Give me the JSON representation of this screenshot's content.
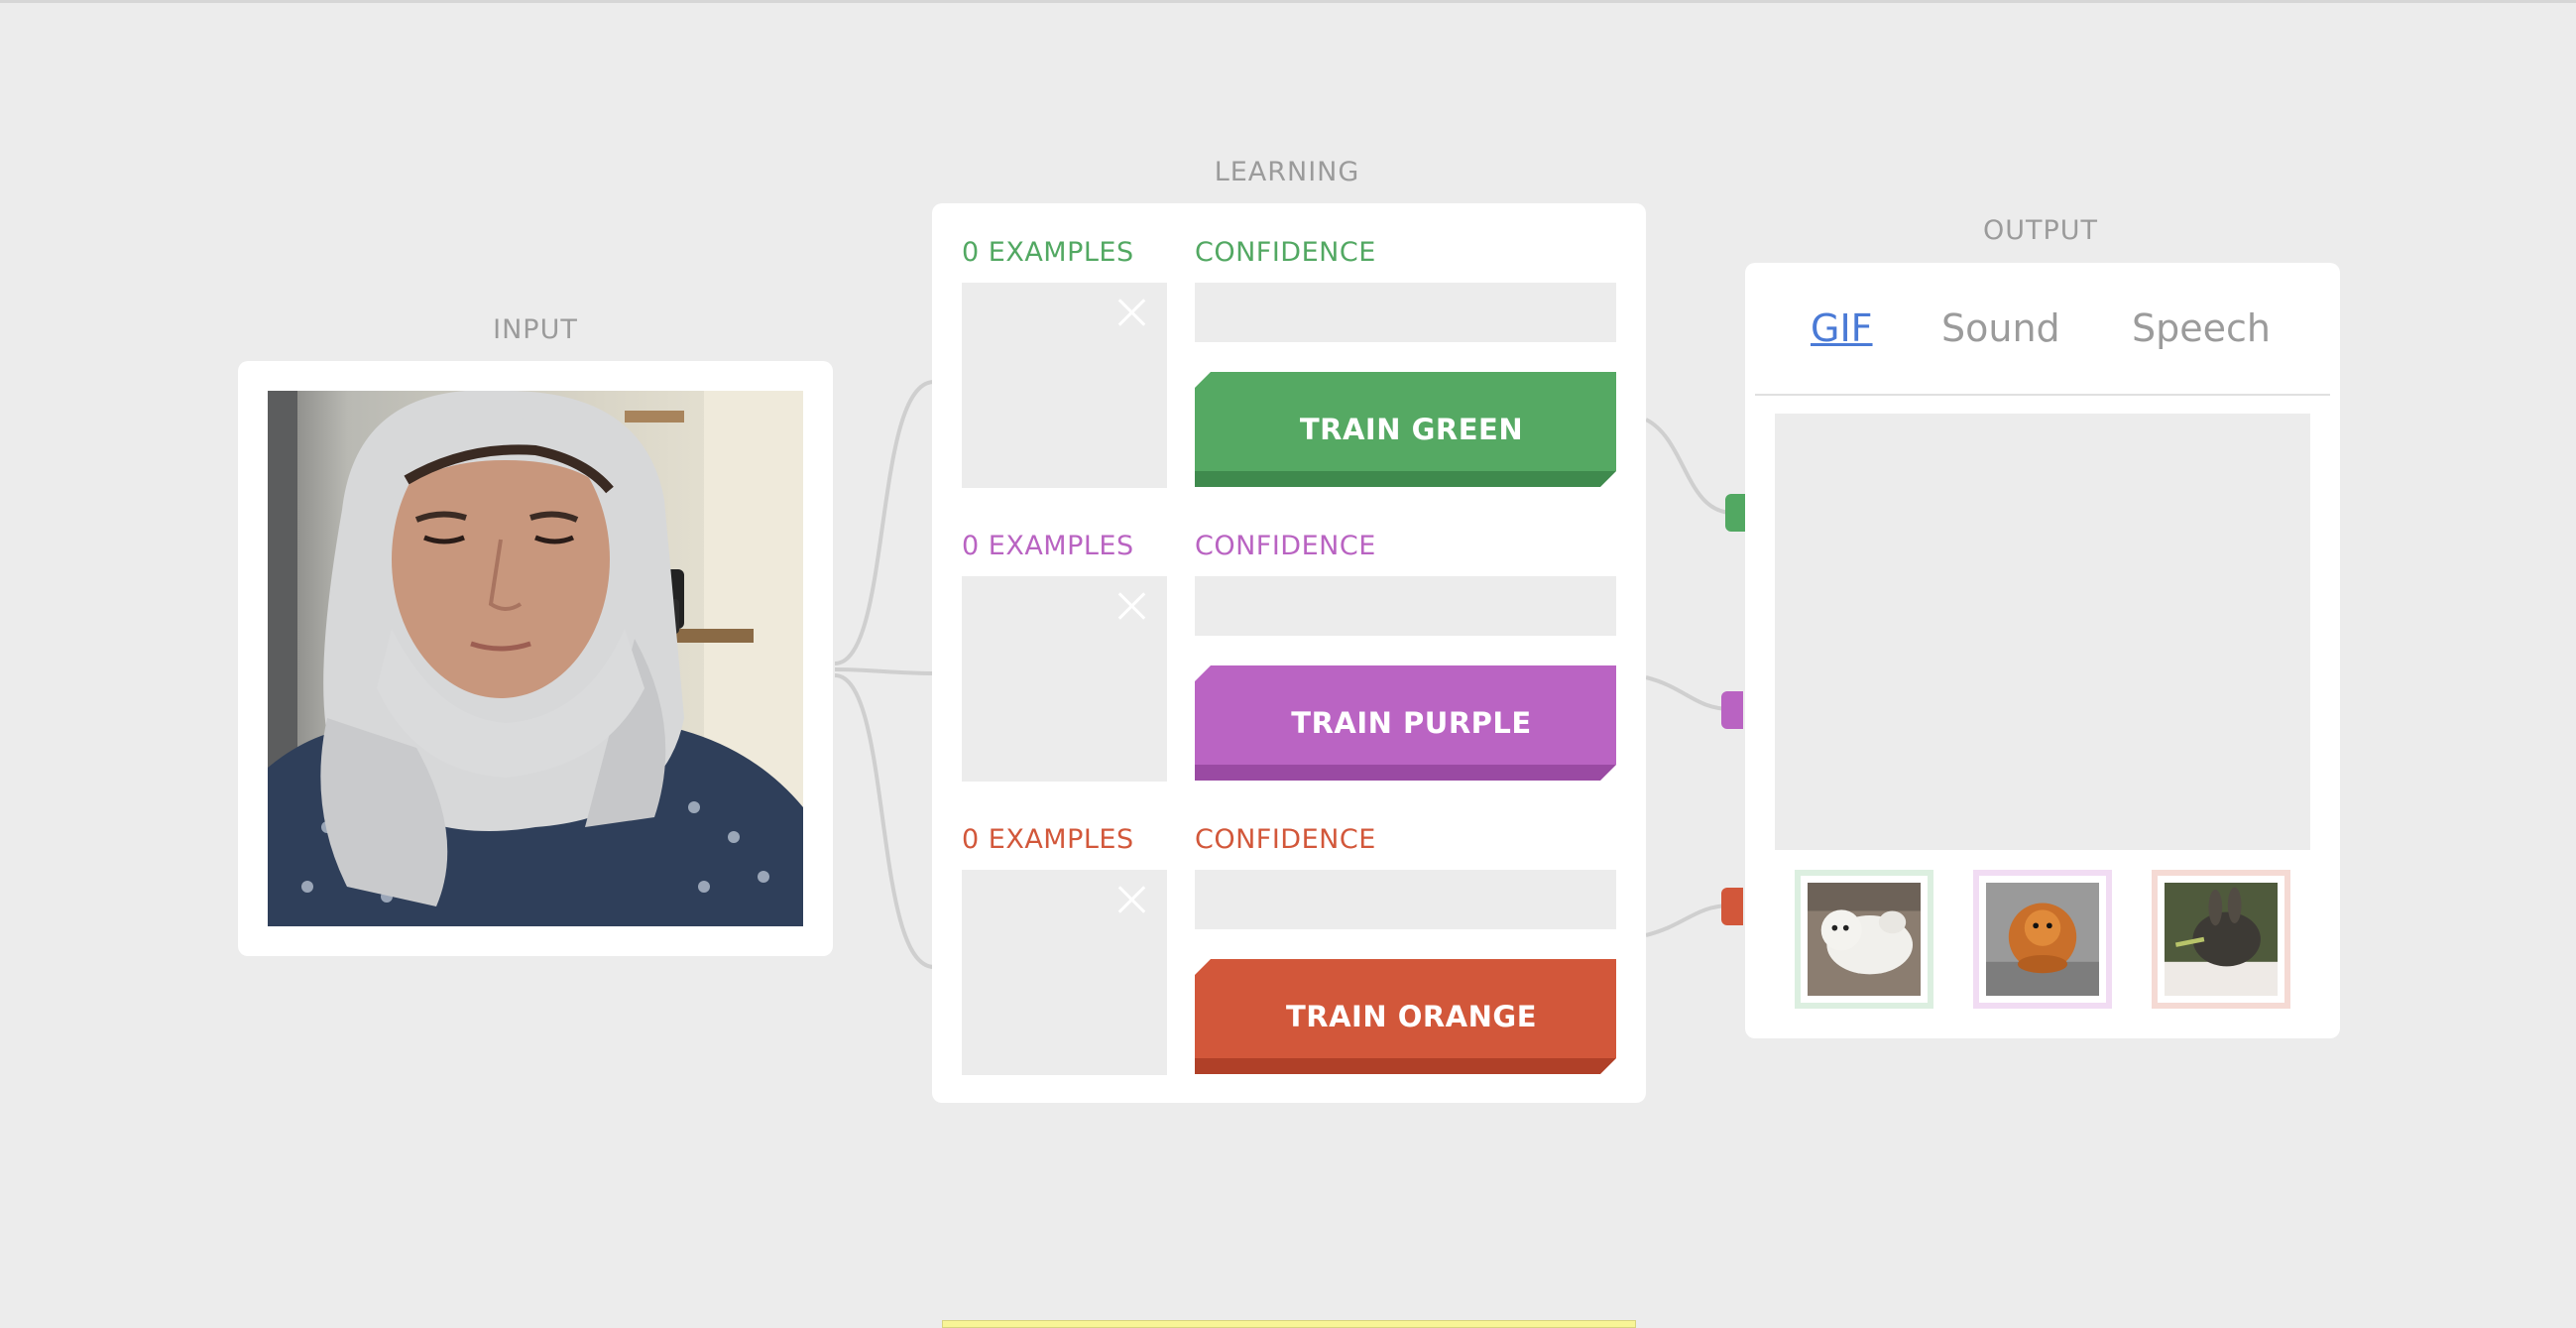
{
  "sections": {
    "input_title": "INPUT",
    "learning_title": "LEARNING",
    "output_title": "OUTPUT"
  },
  "colors": {
    "green": "#52a862",
    "purple": "#b963c2",
    "orange": "#d2573a",
    "tab_active": "#4a7ad6"
  },
  "learning": {
    "rows": [
      {
        "examples": "0 EXAMPLES",
        "confidence": "CONFIDENCE",
        "button": "TRAIN GREEN",
        "color": "#52a862"
      },
      {
        "examples": "0 EXAMPLES",
        "confidence": "CONFIDENCE",
        "button": "TRAIN PURPLE",
        "color": "#b963c2"
      },
      {
        "examples": "0 EXAMPLES",
        "confidence": "CONFIDENCE",
        "button": "TRAIN ORANGE",
        "color": "#d2573a"
      }
    ]
  },
  "output": {
    "tabs": [
      "GIF",
      "Sound",
      "Speech"
    ],
    "active_tab": "GIF",
    "thumbnails": [
      {
        "name": "white-dog-gif",
        "color": "#52a862"
      },
      {
        "name": "orange-dog-gif",
        "color": "#b963c2"
      },
      {
        "name": "rabbit-gif",
        "color": "#d2573a"
      }
    ]
  }
}
